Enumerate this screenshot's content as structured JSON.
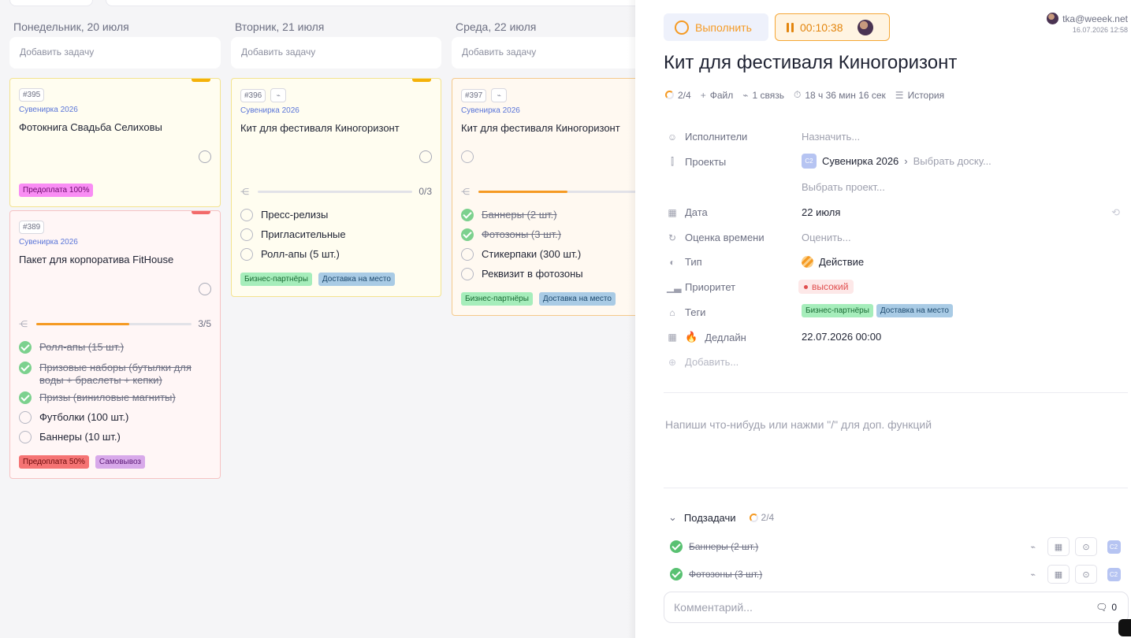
{
  "board": {
    "add_task_label": "Добавить задачу",
    "columns": [
      {
        "day": "Понедельник, 20 июля",
        "cards": [
          {
            "number": "#395",
            "project": "Сувенирка 2026",
            "title": "Фотокнига Свадьба Селиховы",
            "tags": [
              "Предоплата 100%"
            ]
          },
          {
            "number": "#389",
            "project": "Сувенирка 2026",
            "title": "Пакет для корпоратива FitHouse",
            "progress_text": "3/5",
            "progress": 0.6,
            "subtasks": [
              {
                "text": "Ролл-апы (15 шт.)",
                "done": true
              },
              {
                "text": "Призовые наборы (бутылки для воды + браслеты + кепки)",
                "done": true
              },
              {
                "text": "Призы (виниловые магниты)",
                "done": true
              },
              {
                "text": "Футболки (100 шт.)",
                "done": false
              },
              {
                "text": "Баннеры (10 шт.)",
                "done": false
              }
            ],
            "tags": [
              "Предоплата 50%",
              "Самовывоз"
            ]
          }
        ]
      },
      {
        "day": "Вторник, 21 июля",
        "cards": [
          {
            "number": "#396",
            "project": "Сувенирка 2026",
            "title": "Кит для фестиваля Киногоризонт",
            "progress_text": "0/3",
            "progress": 0,
            "subtasks": [
              {
                "text": "Пресс-релизы",
                "done": false
              },
              {
                "text": "Пригласительные",
                "done": false
              },
              {
                "text": "Ролл-апы (5 шт.)",
                "done": false
              }
            ],
            "tags": [
              "Бизнес-партнёры",
              "Доставка на место"
            ]
          }
        ]
      },
      {
        "day": "Среда, 22 июля",
        "cards": [
          {
            "number": "#397",
            "project": "Сувенирка 2026",
            "title": "Кит для фестиваля Киногоризонт",
            "progress": 0.5,
            "subtasks": [
              {
                "text": "Баннеры (2 шт.)",
                "done": true
              },
              {
                "text": "Фотозоны (3 шт.)",
                "done": true
              },
              {
                "text": "Стикерпаки (300 шт.)",
                "done": false
              },
              {
                "text": "Реквизит в фотозоны",
                "done": false
              }
            ],
            "tags": [
              "Бизнес-партнёры",
              "Доставка на место"
            ]
          }
        ]
      }
    ]
  },
  "panel": {
    "do_button": "Выполнить",
    "timer": "00:10:38",
    "owner_email": "tka@weeek.net",
    "owner_date": "16.07.2026 12:58",
    "title": "Кит для фестиваля Киногоризонт",
    "meta": {
      "subtasks": "2/4",
      "file": "Файл",
      "links": "1 связь",
      "time": "18 ч 36 мин 16 сек",
      "history": "История"
    },
    "props": {
      "assignees_label": "Исполнители",
      "assignees_value": "Назначить...",
      "projects_label": "Проекты",
      "project_badge": "C2",
      "project_value": "Сувенирка 2026",
      "board_value": "Выбрать доску...",
      "project_pick": "Выбрать проект...",
      "date_label": "Дата",
      "date_value": "22 июля",
      "estimate_label": "Оценка времени",
      "estimate_value": "Оценить...",
      "type_label": "Тип",
      "type_value": "Действие",
      "priority_label": "Приоритет",
      "priority_value": "высокий",
      "tags_label": "Теги",
      "tags": [
        "Бизнес-партнёры",
        "Доставка на место"
      ],
      "deadline_label": "Дедлайн",
      "deadline_value": "22.07.2026 00:00",
      "add_label": "Добавить..."
    },
    "editor_placeholder": "Напиши что-нибудь или нажми \"/\" для доп. функций",
    "subtasks_header": "Подзадачи",
    "subtasks_count": "2/4",
    "subtasks": [
      {
        "text": "Баннеры (2 шт.)",
        "badge": "C2"
      },
      {
        "text": "Фотозоны (3 шт.)",
        "badge": "C2"
      }
    ],
    "comment_placeholder": "Комментарий...",
    "comment_count": "0"
  },
  "colors": {
    "accent_orange": "#f59a23",
    "project_blue": "#5b76d8",
    "done_green": "#59c172",
    "priority_red": "#e04e4e"
  }
}
